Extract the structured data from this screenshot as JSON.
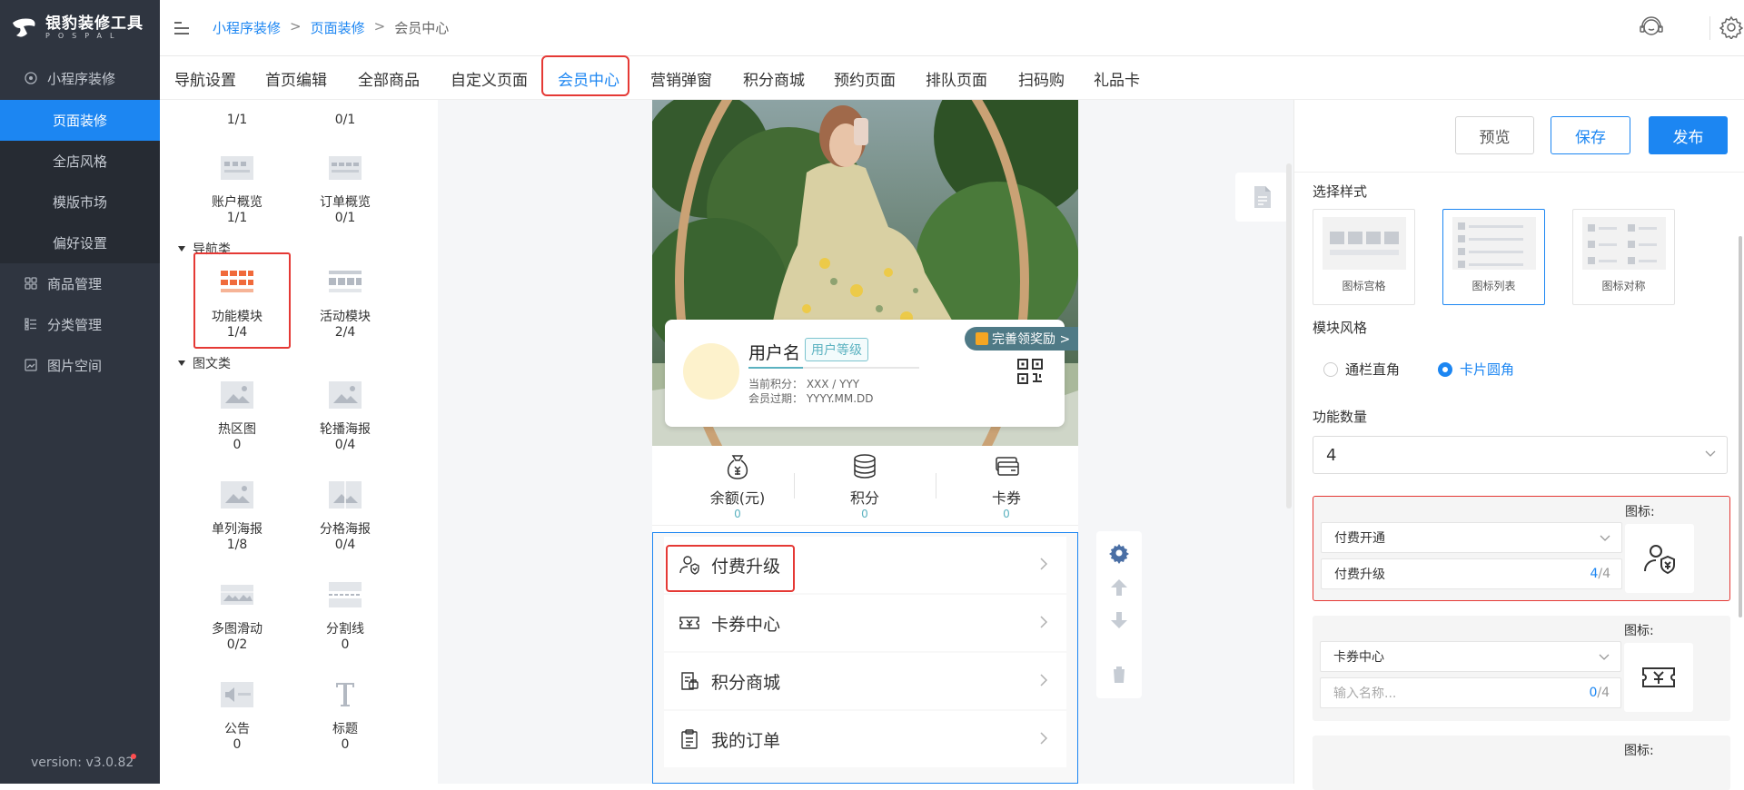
{
  "app": {
    "brand": "银豹装修工具",
    "brand_sub": "POSPAL",
    "version": "version: v3.0.82"
  },
  "sidebar": {
    "groups": [
      {
        "label": "小程序装修",
        "icon": "target-icon"
      },
      {
        "label": "商品管理",
        "icon": "grid-icon"
      },
      {
        "label": "分类管理",
        "icon": "list-icon"
      },
      {
        "label": "图片空间",
        "icon": "image-icon"
      }
    ],
    "subitems": [
      {
        "label": "页面装修",
        "active": true
      },
      {
        "label": "全店风格"
      },
      {
        "label": "模版市场"
      },
      {
        "label": "偏好设置"
      }
    ]
  },
  "breadcrumb": [
    "小程序装修",
    ">",
    "页面装修",
    ">",
    "会员中心"
  ],
  "tabs": [
    "导航设置",
    "首页编辑",
    "全部商品",
    "自定义页面",
    "会员中心",
    "营销弹窗",
    "积分商城",
    "预约页面",
    "排队页面",
    "扫码购",
    "礼品卡"
  ],
  "active_tab": "会员中心",
  "components": {
    "top_counts": [
      "1/1",
      "0/1"
    ],
    "items_a": [
      {
        "label": "账户概览",
        "count": "1/1"
      },
      {
        "label": "订单概览",
        "count": "0/1"
      }
    ],
    "cat_nav": "导航类",
    "items_b": [
      {
        "label": "功能模块",
        "count": "1/4"
      },
      {
        "label": "活动模块",
        "count": "2/4"
      }
    ],
    "cat_media": "图文类",
    "items_c": [
      {
        "label": "热区图",
        "count": "0"
      },
      {
        "label": "轮播海报",
        "count": "0/4"
      },
      {
        "label": "单列海报",
        "count": "1/8"
      },
      {
        "label": "分格海报",
        "count": "0/4"
      },
      {
        "label": "多图滑动",
        "count": "0/2"
      },
      {
        "label": "分割线",
        "count": "0"
      },
      {
        "label": "公告",
        "count": "0"
      },
      {
        "label": "标题",
        "count": "0"
      }
    ]
  },
  "preview": {
    "member": {
      "name": "用户名",
      "level": "用户等级",
      "points": "当前积分： XXX / YYY",
      "expire": "会员过期： YYYY.MM.DD",
      "reward": "完善领奖励 >"
    },
    "stats": [
      {
        "label": "余额(元)",
        "value": "0"
      },
      {
        "label": "积分",
        "value": "0"
      },
      {
        "label": "卡券",
        "value": "0"
      }
    ],
    "rows": [
      "付费升级",
      "卡券中心",
      "积分商城",
      "我的订单"
    ]
  },
  "settings": {
    "buttons": {
      "preview": "预览",
      "save": "保存",
      "publish": "发布"
    },
    "select_style_label": "选择样式",
    "style_options": [
      "图标宫格",
      "图标列表",
      "图标对称"
    ],
    "module_style_label": "模块风格",
    "module_styles": [
      "通栏直角",
      "卡片圆角"
    ],
    "func_count_label": "功能数量",
    "func_count": "4",
    "icon_label": "图标:",
    "blocks": [
      {
        "select": "付费开通",
        "name": "付费升级",
        "count_used": "4",
        "count_total": "/4"
      },
      {
        "select": "卡券中心",
        "name_placeholder": "输入名称...",
        "count_used": "0",
        "count_total": "/4"
      }
    ]
  },
  "colors": {
    "primary": "#1c86f2",
    "sidebar": "#2f3540",
    "highlight": "#e53935",
    "teal": "#5bb2c0"
  }
}
